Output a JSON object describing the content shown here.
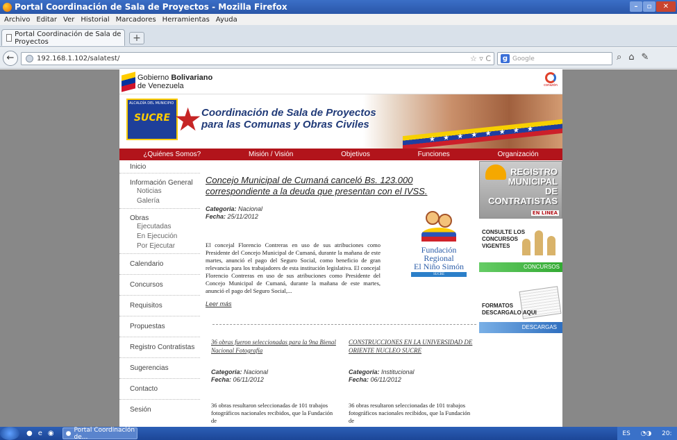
{
  "window": {
    "title": "Portal Coordinación de Sala de Proyectos - Mozilla Firefox",
    "min": "–",
    "max": "▫",
    "close": "✕"
  },
  "menubar": [
    "Archivo",
    "Editar",
    "Ver",
    "Historial",
    "Marcadores",
    "Herramientas",
    "Ayuda"
  ],
  "tab": {
    "label": "Portal Coordinación de Sala de Proyectos",
    "new_tab": "+"
  },
  "nav": {
    "back": "←",
    "url": "192.168.1.102/salatest/",
    "url_right": "☆ ▿ C",
    "search_placeholder": "Google",
    "search_engine_letter": "g",
    "search_icon": "⌕",
    "home_icon": "⌂",
    "addon_icon": "✎"
  },
  "site": {
    "gov_line1": "Gobierno",
    "gov_line1_bold": "Bolivariano",
    "gov_line2": "de Venezuela",
    "corazon": "corazón",
    "sucre_logo_top": "ALCALDÍA DEL MUNICIPIO",
    "sucre_logo_name": "SUCRE",
    "banner_title_1": "Coordinación de Sala de Proyectos",
    "banner_title_2": "para las Comunas y Obras Civiles",
    "ribbon_stars": "★ ★ ★ ★ ★ ★ ★ ★",
    "mainnav": [
      "¿Quiénes Somos?",
      "Misión / Visión",
      "Objetivos",
      "Funciones",
      "Organización"
    ]
  },
  "leftnav": {
    "inicio": "Inicio",
    "info_general": "Información General",
    "info_sub": [
      "Noticias",
      "Galería"
    ],
    "obras": "Obras",
    "obras_sub": [
      "Ejecutadas",
      "En Ejecución",
      "Por Ejecutar"
    ],
    "rest": [
      "Calendario",
      "Concursos",
      "Requisitos",
      "Propuestas",
      "Registro Contratistas",
      "Sugerencias",
      "Contacto",
      "Sesión"
    ]
  },
  "article": {
    "title": "Concejo Municipal de Cumaná canceló Bs. 123.000 correspondiente a la deuda que presentan con el IVSS.",
    "categoria_label": "Categoria:",
    "categoria": "Nacional",
    "fecha_label": "Fecha:",
    "fecha": "25/11/2012",
    "body": "El concejal Florencio Contreras en uso de sus atribuciones como Presidente del Concejo Municipal de Cumaná, durante la mañana de este martes, anunció el pago del Seguro Social, como beneficio de gran relevancia para los trabajadores de esta institución legislativa. El concejal Florencio Contreras en uso de sus atribuciones como Presidente del Concejo Municipal de Cumaná, durante la mañana de este martes, anunció el pago del Seguro Social,...",
    "readmore": "Leer más",
    "fundacion_1": "Fundación Regional",
    "fundacion_2": "El Niño Simón",
    "fundacion_bar": "SUCRE"
  },
  "small_articles": [
    {
      "title": "36 obras fueron seleccionadas para la 9na Bienal Nacional Fotografía",
      "categoria": "Nacional",
      "fecha": "06/11/2012",
      "body": "36 obras resultaron seleccionadas de 101 trabajos fotográficos nacionales recibidos, que la Fundación de"
    },
    {
      "title": "CONSTRUCCIONES EN LA UNIVERSIDAD DE ORIENTE NUCLEO SUCRE",
      "categoria": "Institucional",
      "fecha": "06/11/2012",
      "body": "36 obras resultaron seleccionadas de 101 trabajos fotográficos nacionales recibidos, que la Fundación de"
    }
  ],
  "rightbar": {
    "registro_lines": [
      "REGISTRO",
      "MUNICIPAL",
      "DE",
      "CONTRATISTAS"
    ],
    "en_linea": "EN LINEA",
    "consulte": [
      "CONSULTE LOS",
      "CONCURSOS",
      "VIGENTES"
    ],
    "concursos_bar": "CONCURSOS",
    "formatos": [
      "FORMATOS",
      "DESCARGALO AQUI"
    ],
    "descargas_bar": "DESCARGAS"
  },
  "taskbar": {
    "task_label": "Portal Coordinación de...",
    "lang": "ES",
    "time": "20:"
  },
  "colors": {
    "nav_red": "#b2141b",
    "title_blue": "#203a78",
    "fund_blue": "#2b5da8"
  }
}
